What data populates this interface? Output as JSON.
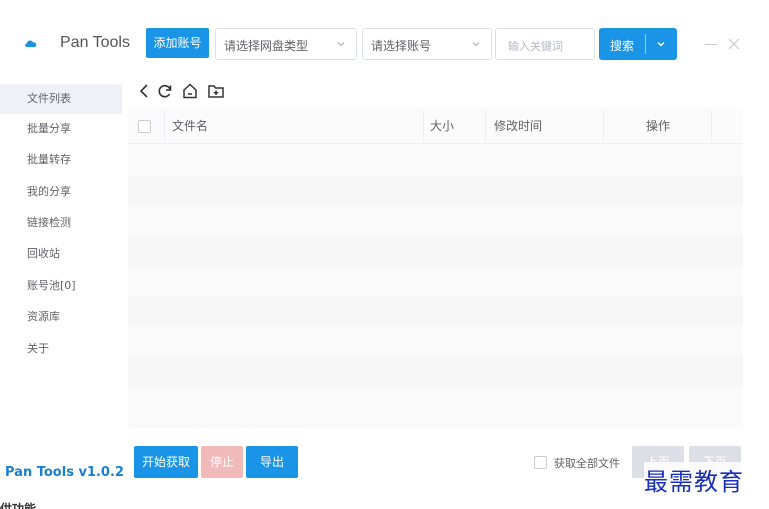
{
  "header": {
    "app_title": "Pan Tools",
    "add_account": "添加账号",
    "disk_type_placeholder": "请选择网盘类型",
    "account_placeholder": "请选择账号",
    "keyword_placeholder": "输入关键词",
    "search_label": "搜索"
  },
  "sidebar": {
    "items": [
      {
        "label": "文件列表",
        "active": true
      },
      {
        "label": "批量分享"
      },
      {
        "label": "批量转存"
      },
      {
        "label": "我的分享"
      },
      {
        "label": "链接检测"
      },
      {
        "label": "回收站"
      },
      {
        "label": "账号池[0]"
      },
      {
        "label": "资源库"
      },
      {
        "label": "关于"
      }
    ],
    "version": "Pan Tools v1.0.2"
  },
  "toolbar": {
    "icons": [
      "back-icon",
      "refresh-icon",
      "home-icon",
      "new-folder-icon"
    ]
  },
  "table": {
    "columns": [
      "文件名",
      "大小",
      "修改时间",
      "操作"
    ],
    "rows": []
  },
  "footer": {
    "start": "开始获取",
    "stop": "停止",
    "export": "导出",
    "get_all": "获取全部文件",
    "prev": "上页",
    "next": "下页"
  },
  "overlay": {
    "watermark": "最需教育",
    "cutoff_text": "供功能"
  },
  "colors": {
    "primary": "#1a94e6",
    "version_text": "#1a7fd0",
    "stop_disabled": "#f2b9b9",
    "page_disabled": "#dcdfe6",
    "watermark": "#1a2fb8"
  }
}
